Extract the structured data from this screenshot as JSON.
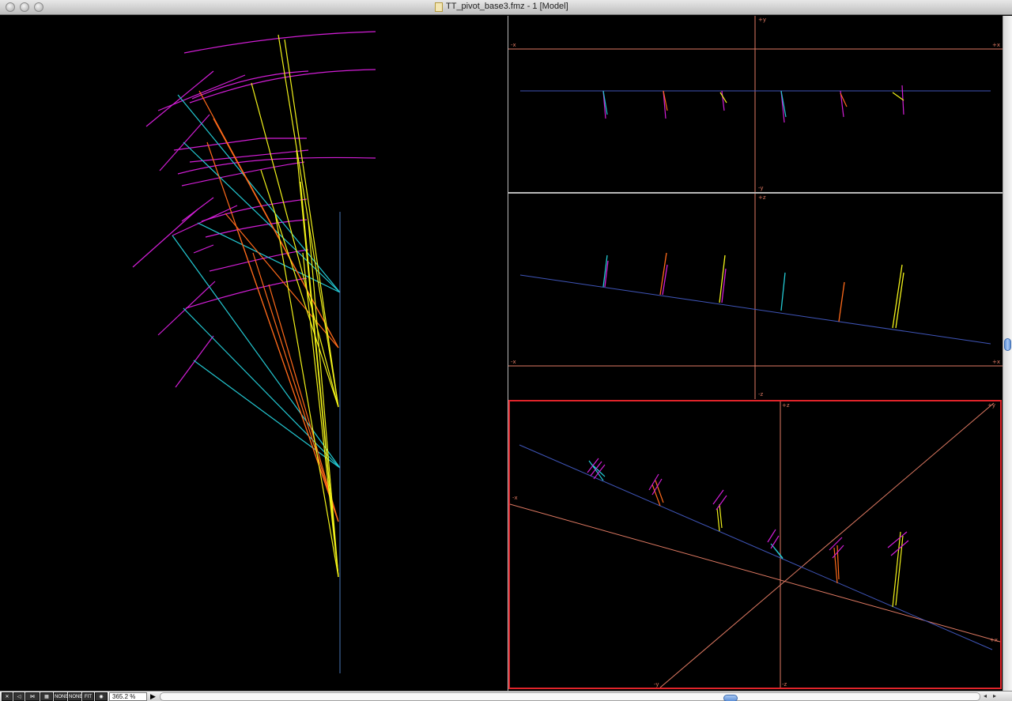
{
  "window": {
    "title": "TT_pivot_base3.fmz - 1 [Model]",
    "traffic_lights": [
      "close",
      "minimize",
      "zoom"
    ]
  },
  "viewports": {
    "front": {
      "labels": {
        "up": "+y",
        "down": "-y",
        "left": "-x",
        "right": "+x"
      }
    },
    "top": {
      "labels": {
        "up": "+z",
        "down": "-z",
        "left": "-x",
        "right": "+x"
      }
    },
    "perspective": {
      "labels": {
        "z_up": "+z",
        "z_down": "-z",
        "x_left": "-x",
        "x_right": "+x",
        "y_up": "+y",
        "y_down": "-y"
      },
      "active_border_color": "#e0242a"
    }
  },
  "colors": {
    "magenta": "#d21ed6",
    "cyan": "#23c8d2",
    "orange": "#ff6a1a",
    "yellow": "#f2f21a",
    "axis": "#e07a63",
    "ground": "#3f55b8",
    "divider": "#b8b8b8"
  },
  "statusbar": {
    "buttons": [
      {
        "name": "select-tool-icon"
      },
      {
        "name": "move-tool-icon"
      },
      {
        "name": "layers-tool-icon"
      },
      {
        "name": "grid-tool-icon"
      },
      {
        "label": "NONE"
      },
      {
        "label": "NONE"
      },
      {
        "label": "FIT"
      },
      {
        "name": "camera-icon"
      }
    ],
    "zoom": "365.2 %"
  }
}
